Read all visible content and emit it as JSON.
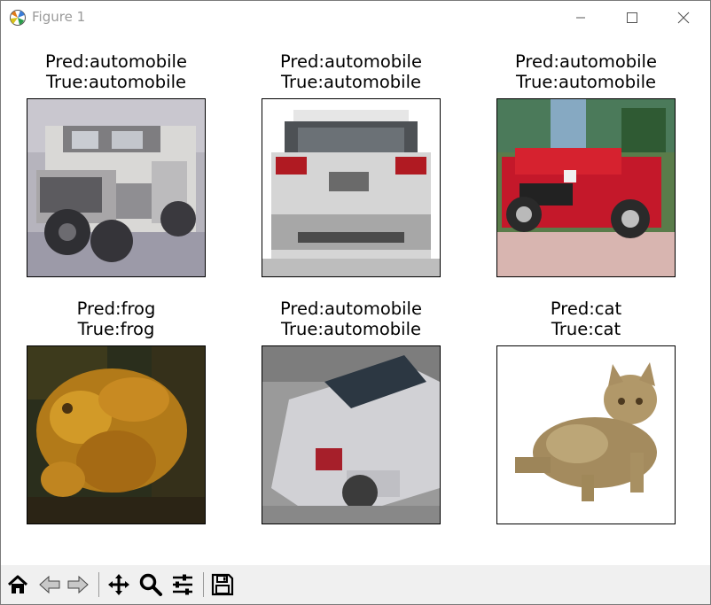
{
  "window": {
    "title": "Figure 1"
  },
  "subplots": [
    {
      "pred": "Pred:automobile",
      "true": "True:automobile",
      "image": "old white jeep automobile"
    },
    {
      "pred": "Pred:automobile",
      "true": "True:automobile",
      "image": "white hatchback rear view"
    },
    {
      "pred": "Pred:automobile",
      "true": "True:automobile",
      "image": "red convertible sports car"
    },
    {
      "pred": "Pred:frog",
      "true": "True:frog",
      "image": "yellow-brown frog"
    },
    {
      "pred": "Pred:automobile",
      "true": "True:automobile",
      "image": "silver convertible rear view"
    },
    {
      "pred": "Pred:cat",
      "true": "True:cat",
      "image": "tabby kitten on white"
    }
  ],
  "toolbar": {
    "buttons": [
      "home-icon",
      "back-icon",
      "forward-icon",
      "pan-icon",
      "zoom-icon",
      "configure-subplots-icon",
      "save-icon"
    ]
  }
}
